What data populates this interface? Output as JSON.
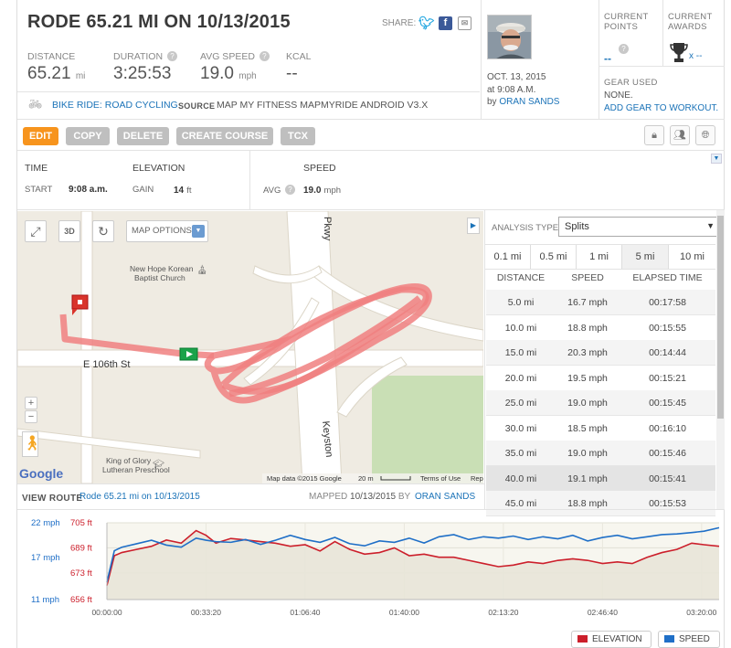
{
  "header": {
    "title": "RODE 65.21 MI ON 10/13/2015",
    "share_label": "SHARE:",
    "stats": [
      {
        "label": "DISTANCE",
        "value": "65.21",
        "unit": "mi",
        "help": false
      },
      {
        "label": "DURATION",
        "value": "3:25:53",
        "unit": "",
        "help": true
      },
      {
        "label": "AVG SPEED",
        "value": "19.0",
        "unit": "mph",
        "help": true
      },
      {
        "label": "KCAL",
        "value": "--",
        "unit": "",
        "help": false
      }
    ],
    "activity_type": "BIKE RIDE: ROAD CYCLING",
    "source_label": "SOURCE",
    "source_value": "MAP MY FITNESS MAPMYRIDE ANDROID V3.X"
  },
  "user": {
    "date": "OCT. 13, 2015",
    "time": "at 9:08 A.M.",
    "by": "by",
    "name": "ORAN SANDS"
  },
  "right_panel": {
    "current_points_label1": "CURRENT",
    "current_points_label2": "POINTS",
    "current_points_value": "--",
    "current_awards_label1": "CURRENT",
    "current_awards_label2": "AWARDS",
    "current_awards_value": "x --",
    "gear_used_label": "GEAR USED",
    "gear_value": "NONE.",
    "add_gear_link": "ADD GEAR TO WORKOUT."
  },
  "toolbar": {
    "edit": "EDIT",
    "copy": "COPY",
    "delete": "DELETE",
    "create_course": "CREATE COURSE",
    "tcx": "TCX"
  },
  "summary": {
    "time_label": "TIME",
    "start_label": "START",
    "start_value": "9:08 a.m.",
    "elevation_label": "ELEVATION",
    "gain_label": "GAIN",
    "gain_value": "14",
    "gain_unit": "ft",
    "speed_label": "SPEED",
    "avg_label": "AVG",
    "avg_value": "19.0",
    "avg_unit": "mph"
  },
  "map": {
    "options_label": "MAP OPTIONS",
    "btn_3d": "3D",
    "zoom_in": "+",
    "zoom_out": "−",
    "google": "Google",
    "labels": {
      "church1": "New Hope Korean",
      "church2": "Baptist Church",
      "street": "E 106th St",
      "pkwy": "Pkwy",
      "keystone": "Keyston",
      "school1": "King of Glory",
      "school2": "Lutheran Preschool"
    },
    "attribution": "Map data ©2015 Google",
    "scale": "20 m",
    "terms": "Terms of Use",
    "report": "Rep"
  },
  "route_footer": {
    "view_route_label": "VIEW ROUTE",
    "route_link": "Rode 65.21 mi on 10/13/2015",
    "mapped_label": "MAPPED",
    "mapped_date": "10/13/2015",
    "by": "BY",
    "mapped_by": "ORAN SANDS"
  },
  "analysis": {
    "type_label": "ANALYSIS TYPE:",
    "selected": "Splits",
    "tabs": [
      "0.1 mi",
      "0.5 mi",
      "1 mi",
      "5 mi",
      "10 mi"
    ],
    "active_tab": 3,
    "columns": [
      "DISTANCE",
      "SPEED",
      "ELAPSED TIME"
    ],
    "rows": [
      {
        "distance": "5.0 mi",
        "speed": "16.7 mph",
        "elapsed": "00:17:58"
      },
      {
        "distance": "10.0 mi",
        "speed": "18.8 mph",
        "elapsed": "00:15:55"
      },
      {
        "distance": "15.0 mi",
        "speed": "20.3 mph",
        "elapsed": "00:14:44"
      },
      {
        "distance": "20.0 mi",
        "speed": "19.5 mph",
        "elapsed": "00:15:21"
      },
      {
        "distance": "25.0 mi",
        "speed": "19.0 mph",
        "elapsed": "00:15:45"
      },
      {
        "distance": "30.0 mi",
        "speed": "18.5 mph",
        "elapsed": "00:16:10"
      },
      {
        "distance": "35.0 mi",
        "speed": "19.0 mph",
        "elapsed": "00:15:46"
      },
      {
        "distance": "40.0 mi",
        "speed": "19.1 mph",
        "elapsed": "00:15:41"
      },
      {
        "distance": "45.0 mi",
        "speed": "18.8 mph",
        "elapsed": "00:15:53"
      }
    ]
  },
  "chart_data": {
    "type": "line",
    "x_ticks": [
      "00:00:00",
      "00:33:20",
      "01:06:40",
      "01:40:00",
      "02:13:20",
      "02:46:40",
      "03:20:00"
    ],
    "x_tick_seconds": [
      0,
      2000,
      4000,
      6000,
      8000,
      10000,
      12000
    ],
    "x_range_seconds": [
      0,
      12353
    ],
    "speed_ticks": [
      "22 mph",
      "17 mph",
      "11 mph"
    ],
    "speed_tick_values": [
      22,
      17,
      11
    ],
    "elev_ticks": [
      "705 ft",
      "689 ft",
      "673 ft",
      "656 ft"
    ],
    "elev_tick_values": [
      705,
      689,
      673,
      656
    ],
    "speed_range": [
      11,
      22
    ],
    "elev_range": [
      656,
      705
    ],
    "series": [
      {
        "name": "ELEVATION",
        "color": "#cc1f2b",
        "x": [
          0,
          150,
          300,
          600,
          900,
          1200,
          1500,
          1800,
          2000,
          2200,
          2500,
          2800,
          3100,
          3400,
          3700,
          4000,
          4300,
          4600,
          4900,
          5200,
          5500,
          5800,
          6100,
          6400,
          6700,
          7000,
          7300,
          7600,
          7900,
          8200,
          8500,
          8800,
          9100,
          9400,
          9700,
          10000,
          10300,
          10600,
          10900,
          11200,
          11500,
          11800,
          12050,
          12353
        ],
        "values": [
          665,
          684,
          686,
          688,
          690,
          694,
          692,
          700,
          697,
          692,
          695,
          694,
          693,
          692,
          690,
          691,
          687,
          693,
          688,
          685,
          686,
          689,
          684,
          685,
          683,
          683,
          681,
          679,
          677,
          678,
          680,
          679,
          681,
          682,
          681,
          679,
          680,
          679,
          683,
          686,
          688,
          692,
          691,
          690
        ]
      },
      {
        "name": "SPEED",
        "color": "#1f6fc7",
        "x": [
          0,
          150,
          300,
          600,
          900,
          1200,
          1500,
          1800,
          2000,
          2200,
          2500,
          2800,
          3100,
          3400,
          3700,
          4000,
          4300,
          4600,
          4900,
          5200,
          5500,
          5800,
          6100,
          6400,
          6700,
          7000,
          7300,
          7600,
          7900,
          8200,
          8500,
          8800,
          9100,
          9400,
          9700,
          10000,
          10300,
          10600,
          10900,
          11200,
          11500,
          11800,
          12050,
          12353
        ],
        "values": [
          13.5,
          18.0,
          18.5,
          19.0,
          19.5,
          18.8,
          18.5,
          19.8,
          19.5,
          19.3,
          19.2,
          19.6,
          18.9,
          19.5,
          20.2,
          19.6,
          19.2,
          19.9,
          19.0,
          18.7,
          19.4,
          19.2,
          19.8,
          19.1,
          20.0,
          20.3,
          19.6,
          20.0,
          19.8,
          20.1,
          19.6,
          20.0,
          19.7,
          20.2,
          19.4,
          19.9,
          20.2,
          19.7,
          20.0,
          20.3,
          20.4,
          20.6,
          20.8,
          21.3
        ]
      }
    ],
    "legend": [
      "ELEVATION",
      "SPEED"
    ],
    "legend_position": "bottom-right"
  }
}
